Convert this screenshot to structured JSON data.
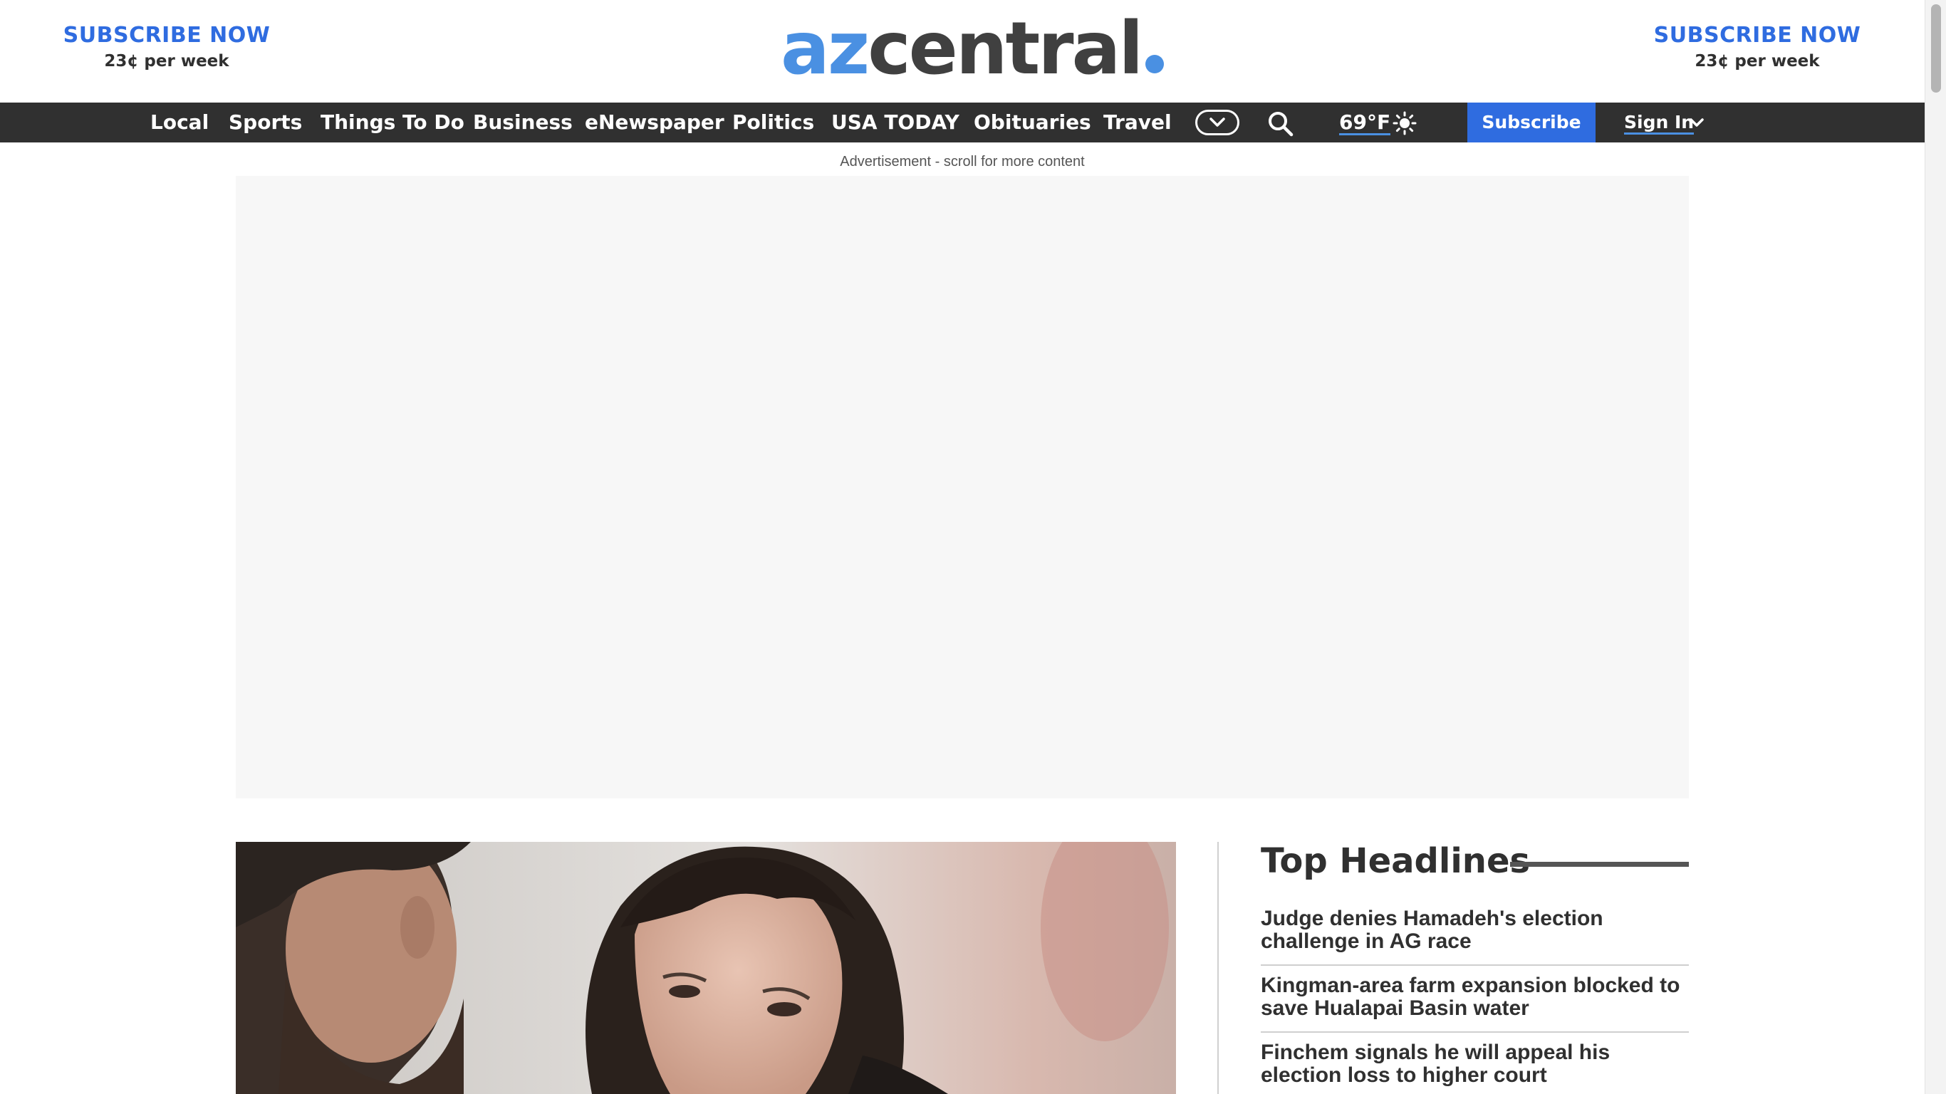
{
  "masthead": {
    "promo_left": {
      "title": "SUBSCRIBE NOW",
      "subtitle": "23¢ per week"
    },
    "promo_right": {
      "title": "SUBSCRIBE NOW",
      "subtitle": "23¢ per week"
    },
    "logo": {
      "part1": "az",
      "part2": "central"
    }
  },
  "nav": {
    "items": [
      "Local",
      "Sports",
      "Things To Do",
      "Business",
      "eNewspaper",
      "Politics",
      "USA TODAY",
      "Obituaries",
      "Travel"
    ],
    "more_icon": "chevron-down-icon",
    "search_icon": "search-icon",
    "weather": {
      "temperature": "69°F",
      "icon": "sun-icon"
    },
    "subscribe_label": "Subscribe",
    "signin_label": "Sign In"
  },
  "ad": {
    "label": "Advertisement - scroll for more content"
  },
  "headlines": {
    "title": "Top Headlines",
    "items": [
      "Judge denies Hamadeh's election challenge in AG race",
      "Kingman-area farm expansion blocked to save Hualapai Basin water",
      "Finchem signals he will appeal his election loss to higher court"
    ]
  },
  "colors": {
    "brand_blue": "#2f6ce0",
    "logo_blue": "#4a90e2",
    "nav_bg": "#303030",
    "ad_bg": "#f7f7f7"
  }
}
